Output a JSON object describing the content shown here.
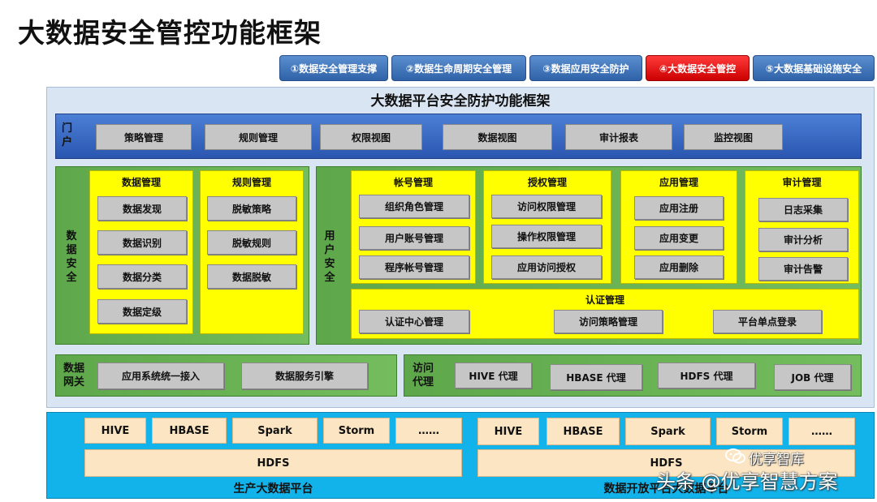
{
  "page_title": "大数据安全管控功能框架",
  "nav_tabs": [
    {
      "label": "①数据安全管理支撑",
      "active": false
    },
    {
      "label": "②数据生命周期安全管理",
      "active": false
    },
    {
      "label": "③数据应用安全防护",
      "active": false
    },
    {
      "label": "④大数据安全管控",
      "active": true
    },
    {
      "label": "⑤大数据基础设施安全",
      "active": false
    }
  ],
  "framework": {
    "title": "大数据平台安全防护功能框架",
    "portal": {
      "label": "门户",
      "items": [
        "策略管理",
        "规则管理",
        "权限视图",
        "数据视图",
        "审计报表",
        "监控视图"
      ]
    },
    "data_security": {
      "label": "数据安全",
      "data_mgmt": {
        "title": "数据管理",
        "items": [
          "数据发现",
          "数据识别",
          "数据分类",
          "数据定级"
        ]
      },
      "rule_mgmt": {
        "title": "规则管理",
        "items": [
          "脱敏策略",
          "脱敏规则",
          "数据脱敏"
        ]
      }
    },
    "user_security": {
      "label": "用户安全",
      "account_mgmt": {
        "title": "帐号管理",
        "items": [
          "组织角色管理",
          "用户账号管理",
          "程序帐号管理"
        ]
      },
      "auth_mgmt": {
        "title": "授权管理",
        "items": [
          "访问权限管理",
          "操作权限管理",
          "应用访问授权"
        ]
      },
      "app_mgmt": {
        "title": "应用管理",
        "items": [
          "应用注册",
          "应用变更",
          "应用删除"
        ]
      },
      "audit_mgmt": {
        "title": "审计管理",
        "items": [
          "日志采集",
          "审计分析",
          "审计告警"
        ]
      },
      "authn_mgmt": {
        "title": "认证管理",
        "items": [
          "认证中心管理",
          "访问策略管理",
          "平台单点登录"
        ]
      }
    },
    "data_gateway": {
      "label": "数据网关",
      "items": [
        "应用系统统一接入",
        "数据服务引擎"
      ]
    },
    "access_proxy": {
      "label": "访问代理",
      "items": [
        "HIVE 代理",
        "HBASE 代理",
        "HDFS 代理",
        "JOB 代理"
      ]
    }
  },
  "platforms": {
    "production": {
      "label": "生产大数据平台",
      "components": [
        "HIVE",
        "HBASE",
        "Spark",
        "Storm",
        "……"
      ],
      "storage": "HDFS"
    },
    "open": {
      "label": "数据开放平台大数据平台",
      "components": [
        "HIVE",
        "HBASE",
        "Spark",
        "Storm",
        "……"
      ],
      "storage": "HDFS"
    }
  },
  "watermark": {
    "brand": "优享智库",
    "text": "头条 @优享智慧方案"
  },
  "colors": {
    "tab_default": "#2f62a8",
    "tab_active": "#cc0000",
    "portal": "#2a56b0",
    "security_green": "#5ea84b",
    "group_yellow": "#ffff00",
    "platform_cyan": "#12b3ea",
    "platform_box": "#fbe5c2"
  }
}
